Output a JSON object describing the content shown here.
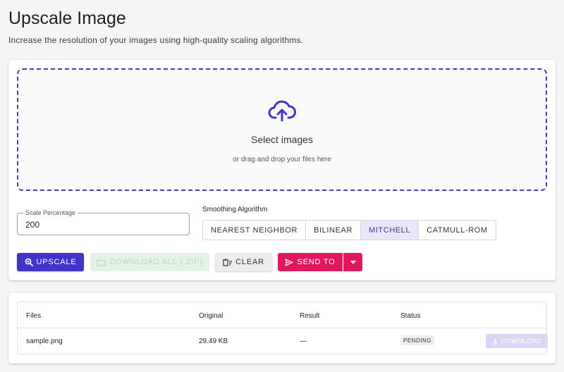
{
  "page": {
    "title": "Upscale Image",
    "subtitle": "Increase the resolution of your images using high-quality scaling algorithms."
  },
  "dropzone": {
    "icon": "cloud-upload-icon",
    "title": "Select images",
    "hint": "or drag and drop your files here"
  },
  "scale": {
    "label": "Scale Percentage",
    "value": "200"
  },
  "smoothing": {
    "label": "Smoothing Algorithm",
    "options": [
      "NEAREST NEIGHBOR",
      "BILINEAR",
      "MITCHELL",
      "CATMULL-ROM"
    ],
    "selected": "MITCHELL"
  },
  "actions": {
    "upscale": "UPSCALE",
    "download_all": "DOWNLOAD ALL (.ZIP)",
    "clear": "CLEAR",
    "send_to": "SEND TO"
  },
  "table": {
    "headers": {
      "files": "Files",
      "original": "Original",
      "result": "Result",
      "status": "Status"
    },
    "rows": [
      {
        "file": "sample.png",
        "original": "29.49 KB",
        "result": "—",
        "status": "PENDING",
        "download": "DOWNLOAD"
      }
    ]
  },
  "colors": {
    "primary": "#4233c9",
    "accent": "#e0185f",
    "success_disabled": "#e3f2e5"
  }
}
